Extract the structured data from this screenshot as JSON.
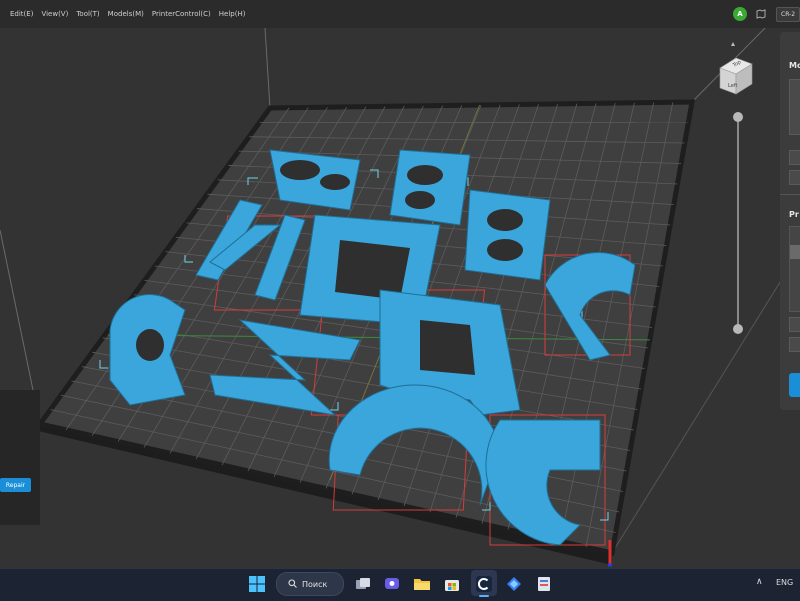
{
  "menu": {
    "items": [
      {
        "label": "Edit(E)"
      },
      {
        "label": "View(V)"
      },
      {
        "label": "Tool(T)"
      },
      {
        "label": "Models(M)"
      },
      {
        "label": "PrinterControl(C)"
      },
      {
        "label": "Help(H)"
      }
    ],
    "user_initial": "A",
    "printer_label": "CR-2"
  },
  "viewcube": {
    "top_label": "Top",
    "side_label": "Left"
  },
  "right_panel": {
    "title_models": "Mo",
    "title_printer": "Pr"
  },
  "left_panel": {
    "repair_label": "Repair"
  },
  "taskbar": {
    "search_label": "Поиск",
    "language": "ENG",
    "icons": [
      "windows-start-icon",
      "search-icon",
      "task-view-icon",
      "chat-icon",
      "file-explorer-icon",
      "store-icon",
      "creality-print-icon",
      "copilot-icon",
      "app-icon"
    ]
  },
  "colors": {
    "model_blue": "#3aa6dc",
    "plate": "#3f3f3f",
    "grid_line": "#5c5c5c",
    "accent": "#1a8fd8"
  }
}
